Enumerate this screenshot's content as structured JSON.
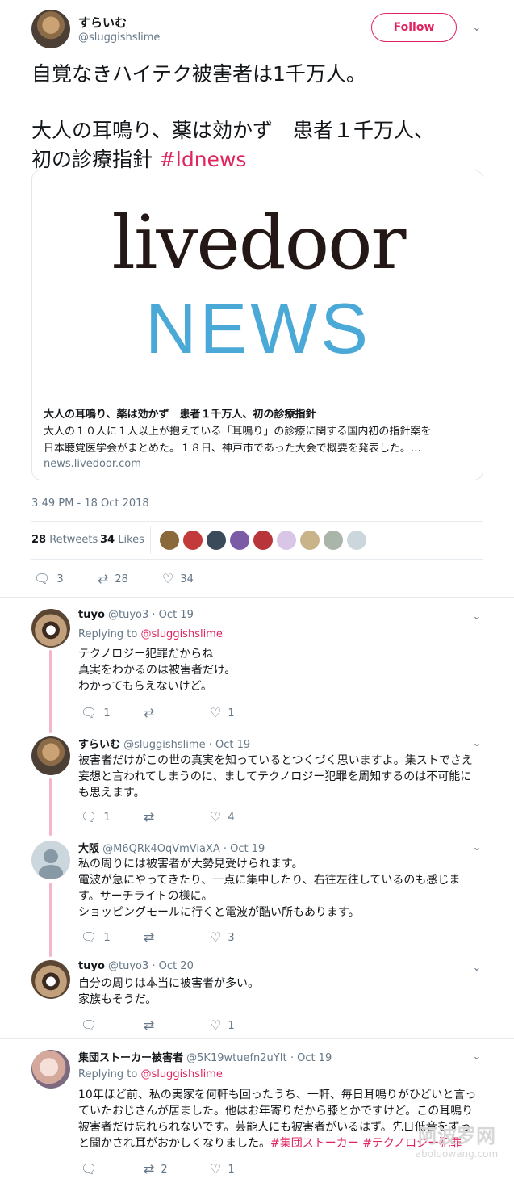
{
  "colors": {
    "accent": "#e0245e",
    "muted": "#657786",
    "border": "#e1e8ed",
    "thread": "#f7b5ca",
    "news_blue": "#4aa9d6"
  },
  "main_tweet": {
    "display_name": "すらいむ",
    "handle": "@sluggishslime",
    "follow_label": "Follow",
    "text_line1": "自覚なきハイテク被害者は1千万人。",
    "text_line2": "大人の耳鳴り、薬は効かず　患者１千万人、",
    "text_line3": "初の診療指針 ",
    "hashtag": "#ldnews",
    "card": {
      "logo_top": "livedoor",
      "logo_bottom": "NEWS",
      "title": "大人の耳鳴り、薬は効かず　患者１千万人、初の診療指針",
      "description_line1": "大人の１０人に１人以上が抱えている「耳鳴り」の診療に関する国内初の指針案を",
      "description_line2": "日本聴覚医学会がまとめた。１８日、神戸市であった大会で概要を発表した。…",
      "domain": "news.livedoor.com"
    },
    "timestamp": "3:49 PM - 18 Oct 2018",
    "retweets_count": "28",
    "retweets_label": "Retweets",
    "likes_count": "34",
    "likes_label": "Likes",
    "likers_avatar_colors": [
      "#8a6a3a",
      "#c23a3a",
      "#3b4a5a",
      "#7b5aa6",
      "#b8353a",
      "#d9c6e6",
      "#c9b48a",
      "#a9b5a8",
      "#ccd6dd"
    ],
    "actions": {
      "replies": "3",
      "retweets": "28",
      "likes": "34"
    }
  },
  "replies": [
    {
      "display_name": "tuyo",
      "handle": "@tuyo3",
      "date": "· Oct 19",
      "replying_to_label": "Replying to ",
      "replying_to": "@sluggishslime",
      "lines": [
        "テクノロジー犯罪だからね",
        "真実をわかるのは被害者だけ。",
        "わかってもらえないけど。"
      ],
      "replies": "1",
      "retweets": "",
      "likes": "1"
    },
    {
      "display_name": "すらいむ",
      "handle": "@sluggishslime",
      "date": "· Oct 19",
      "lines": [
        "被害者だけがこの世の真実を知っているとつくづく思いますよ。集ストでさえ",
        "妄想と言われてしまうのに、ましてテクノロジー犯罪を周知するのは不可能に",
        "も思えます。"
      ],
      "replies": "1",
      "retweets": "",
      "likes": "4"
    },
    {
      "display_name": "大阪",
      "handle": "@M6QRk4OqVmViaXA",
      "date": "· Oct 19",
      "lines": [
        "私の周りには被害者が大勢見受けられます。",
        "電波が急にやってきたり、一点に集中したり、右往左往しているのも感じま",
        "す。サーチライトの様に。",
        "ショッピングモールに行くと電波が酷い所もあります。"
      ],
      "replies": "1",
      "retweets": "",
      "likes": "3"
    },
    {
      "display_name": "tuyo",
      "handle": "@tuyo3",
      "date": "· Oct 20",
      "lines": [
        "自分の周りは本当に被害者が多い。",
        "家族もそうだ。"
      ],
      "replies": "",
      "retweets": "",
      "likes": "1"
    },
    {
      "display_name": "集団ストーカー被害者",
      "handle": "@5K19wtuefn2uYIt",
      "date": "· Oct 19",
      "replying_to_label": "Replying to ",
      "replying_to": "@sluggishslime",
      "lines": [
        "10年ほど前、私の実家を何軒も回ったうち、一軒、毎日耳鳴りがひどいと言っ",
        "ていたおじさんが居ました。他はお年寄りだから膝とかですけど。この耳鳴り",
        "被害者だけ忘れられないです。芸能人にも被害者がいるはず。先日低音をずっ",
        "と聞かされ耳がおかしくなりました。"
      ],
      "hashtag1": "#集団ストーカー",
      "hashtag2": "#テクノロジー犯罪",
      "replies": "",
      "retweets": "2",
      "likes": "1"
    }
  ],
  "watermark": {
    "top": "阿波罗网",
    "bottom": "aboluowang.com"
  }
}
